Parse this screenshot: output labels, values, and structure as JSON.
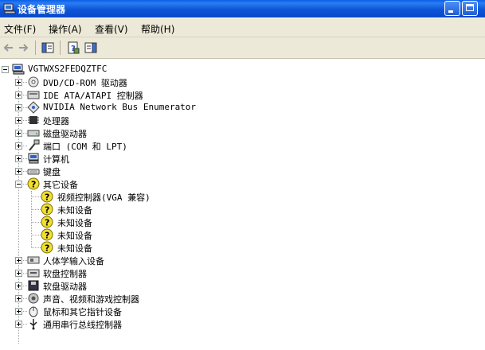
{
  "window": {
    "title": "设备管理器"
  },
  "menu": [
    {
      "label": "文件(F)"
    },
    {
      "label": "操作(A)"
    },
    {
      "label": "查看(V)"
    },
    {
      "label": "帮助(H)"
    }
  ],
  "toolbar": {
    "icons": [
      "back-arrow-icon",
      "forward-arrow-icon",
      "show-hide-console-tree-icon",
      "properties-icon",
      "help-icon"
    ]
  },
  "tree": {
    "root": "VGTWXS2FEDQZTFC",
    "items": [
      {
        "label": "DVD/CD-ROM 驱动器",
        "icon": "cdrom-icon"
      },
      {
        "label": "IDE ATA/ATAPI 控制器",
        "icon": "ide-controller-icon"
      },
      {
        "label": "NVIDIA Network Bus Enumerator",
        "icon": "network-bus-icon"
      },
      {
        "label": "处理器",
        "icon": "processor-icon"
      },
      {
        "label": "磁盘驱动器",
        "icon": "disk-drive-icon"
      },
      {
        "label": "端口 (COM 和 LPT)",
        "icon": "port-icon"
      },
      {
        "label": "计算机",
        "icon": "computer-icon"
      },
      {
        "label": "键盘",
        "icon": "keyboard-icon"
      },
      {
        "label": "其它设备",
        "icon": "unknown-device-icon",
        "expanded": true,
        "children": [
          {
            "label": "视频控制器(VGA 兼容)"
          },
          {
            "label": "未知设备"
          },
          {
            "label": "未知设备"
          },
          {
            "label": "未知设备"
          },
          {
            "label": "未知设备"
          }
        ]
      },
      {
        "label": "人体学输入设备",
        "icon": "hid-icon"
      },
      {
        "label": "软盘控制器",
        "icon": "floppy-controller-icon"
      },
      {
        "label": "软盘驱动器",
        "icon": "floppy-drive-icon"
      },
      {
        "label": "声音、视频和游戏控制器",
        "icon": "sound-icon"
      },
      {
        "label": "鼠标和其它指针设备",
        "icon": "mouse-icon"
      },
      {
        "label": "通用串行总线控制器",
        "icon": "usb-icon"
      }
    ]
  }
}
